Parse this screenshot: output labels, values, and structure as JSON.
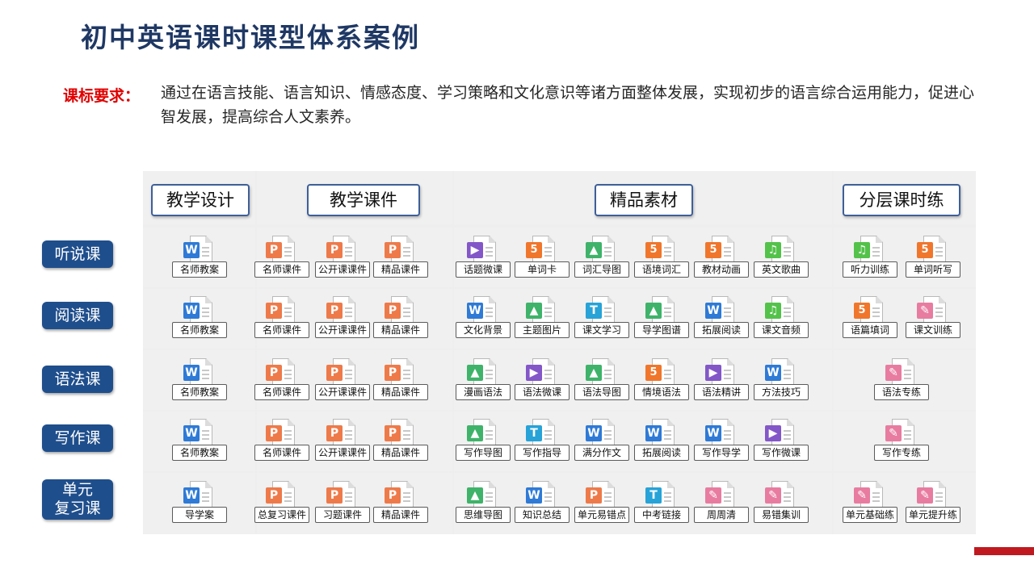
{
  "title": "初中英语课时课型体系案例",
  "requirement": {
    "label": "课标要求：",
    "text": "通过在语言技能、语言知识、情感态度、学习策略和文化意识等诸方面整体发展，实现初步的语言综合运用能力，促进心智发展，提高综合人文素养。"
  },
  "columns": [
    "教学设计",
    "教学课件",
    "精品素材",
    "分层课时练"
  ],
  "rows": [
    {
      "label": "听说课",
      "design": [
        {
          "label": "名师教案",
          "icon": "word-doc-icon"
        }
      ],
      "courseware": [
        {
          "label": "名师课件",
          "icon": "ppt-doc-icon"
        },
        {
          "label": "公开课课件",
          "icon": "ppt-doc-icon"
        },
        {
          "label": "精品课件",
          "icon": "ppt-doc-icon"
        }
      ],
      "materials": [
        {
          "label": "话题微课",
          "icon": "video-doc-icon"
        },
        {
          "label": "单词卡",
          "icon": "html5-doc-icon"
        },
        {
          "label": "词汇导图",
          "icon": "image-doc-icon"
        },
        {
          "label": "语境词汇",
          "icon": "html5-doc-icon"
        },
        {
          "label": "教材动画",
          "icon": "html5-doc-icon"
        },
        {
          "label": "英文歌曲",
          "icon": "music-doc-icon"
        }
      ],
      "exercises": [
        {
          "label": "听力训练",
          "icon": "music-doc-icon"
        },
        {
          "label": "单词听写",
          "icon": "html5-doc-icon"
        }
      ]
    },
    {
      "label": "阅读课",
      "design": [
        {
          "label": "名师教案",
          "icon": "word-doc-icon"
        }
      ],
      "courseware": [
        {
          "label": "名师课件",
          "icon": "ppt-doc-icon"
        },
        {
          "label": "公开课课件",
          "icon": "ppt-doc-icon"
        },
        {
          "label": "精品课件",
          "icon": "ppt-doc-icon"
        }
      ],
      "materials": [
        {
          "label": "文化背景",
          "icon": "word-doc-icon"
        },
        {
          "label": "主题图片",
          "icon": "image-doc-icon"
        },
        {
          "label": "课文学习",
          "icon": "text-doc-icon"
        },
        {
          "label": "导学图谱",
          "icon": "image-doc-icon"
        },
        {
          "label": "拓展阅读",
          "icon": "word-doc-icon"
        },
        {
          "label": "课文音频",
          "icon": "music-doc-icon"
        }
      ],
      "exercises": [
        {
          "label": "语篇填词",
          "icon": "html5-doc-icon"
        },
        {
          "label": "课文训练",
          "icon": "pen-doc-icon"
        }
      ]
    },
    {
      "label": "语法课",
      "design": [
        {
          "label": "名师教案",
          "icon": "word-doc-icon"
        }
      ],
      "courseware": [
        {
          "label": "名师课件",
          "icon": "ppt-doc-icon"
        },
        {
          "label": "公开课课件",
          "icon": "ppt-doc-icon"
        },
        {
          "label": "精品课件",
          "icon": "ppt-doc-icon"
        }
      ],
      "materials": [
        {
          "label": "漫画语法",
          "icon": "image-doc-icon"
        },
        {
          "label": "语法微课",
          "icon": "video-doc-icon"
        },
        {
          "label": "语法导图",
          "icon": "image-doc-icon"
        },
        {
          "label": "情境语法",
          "icon": "html5-doc-icon"
        },
        {
          "label": "语法精讲",
          "icon": "video-doc-icon"
        },
        {
          "label": "方法技巧",
          "icon": "word-doc-icon"
        }
      ],
      "exercises": [
        {
          "label": "语法专练",
          "icon": "pen-doc-icon"
        }
      ]
    },
    {
      "label": "写作课",
      "design": [
        {
          "label": "名师教案",
          "icon": "word-doc-icon"
        }
      ],
      "courseware": [
        {
          "label": "名师课件",
          "icon": "ppt-doc-icon"
        },
        {
          "label": "公开课课件",
          "icon": "ppt-doc-icon"
        },
        {
          "label": "精品课件",
          "icon": "ppt-doc-icon"
        }
      ],
      "materials": [
        {
          "label": "写作导图",
          "icon": "image-doc-icon"
        },
        {
          "label": "写作指导",
          "icon": "text-doc-icon"
        },
        {
          "label": "满分作文",
          "icon": "word-doc-icon"
        },
        {
          "label": "拓展阅读",
          "icon": "word-doc-icon"
        },
        {
          "label": "写作导学",
          "icon": "word-doc-icon"
        },
        {
          "label": "写作微课",
          "icon": "video-doc-icon"
        }
      ],
      "exercises": [
        {
          "label": "写作专练",
          "icon": "pen-doc-icon"
        }
      ]
    },
    {
      "label": "单元\n复习课",
      "label_lines": [
        "单元",
        "复习课"
      ],
      "design": [
        {
          "label": "导学案",
          "icon": "word-doc-icon"
        }
      ],
      "courseware": [
        {
          "label": "总复习课件",
          "icon": "ppt-doc-icon"
        },
        {
          "label": "习题课件",
          "icon": "ppt-doc-icon"
        },
        {
          "label": "精品课件",
          "icon": "ppt-doc-icon"
        }
      ],
      "materials": [
        {
          "label": "思维导图",
          "icon": "image-doc-icon"
        },
        {
          "label": "知识总结",
          "icon": "word-doc-icon"
        },
        {
          "label": "单元易错点",
          "icon": "ppt-doc-icon"
        },
        {
          "label": "中考链接",
          "icon": "text-doc-icon"
        },
        {
          "label": "周周清",
          "icon": "pen-doc-icon"
        },
        {
          "label": "易错集训",
          "icon": "pen-doc-icon"
        }
      ],
      "exercises": [
        {
          "label": "单元基础练",
          "icon": "pen-doc-icon"
        },
        {
          "label": "单元提升练",
          "icon": "pen-doc-icon"
        }
      ]
    }
  ],
  "icon_glyphs": {
    "word-doc-icon": "W",
    "ppt-doc-icon": "P",
    "html5-doc-icon": "5",
    "image-doc-icon": "▲",
    "video-doc-icon": "▶",
    "text-doc-icon": "T",
    "music-doc-icon": "♫",
    "pen-doc-icon": "✎"
  },
  "colors": {
    "title": "#1f3864",
    "requirement_label": "#e00000",
    "row_label_bg": "#1f4e8c",
    "accent_bar": "#c0191f"
  }
}
